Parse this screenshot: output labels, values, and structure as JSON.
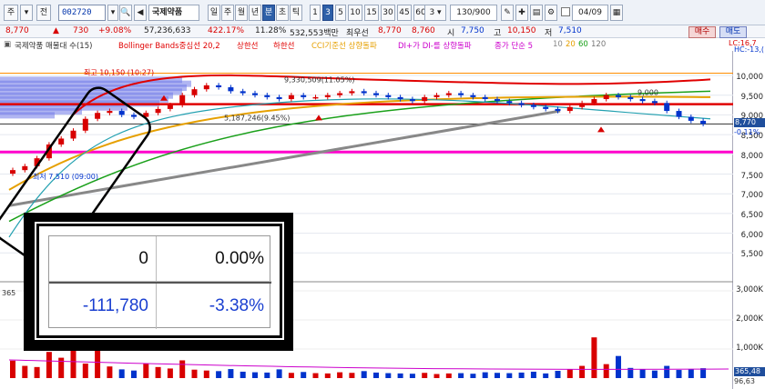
{
  "toolbar": {
    "period_main": "주",
    "period_sub": "전",
    "stock_code": "002720",
    "stock_name": "국제약품",
    "tabs": [
      "일",
      "주",
      "월",
      "년",
      "분",
      "초",
      "틱"
    ],
    "active_tab": "분",
    "minute_options": [
      "1",
      "3",
      "5",
      "10",
      "15",
      "30",
      "45",
      "60"
    ],
    "active_minute": "3",
    "interval_select": "3",
    "display_count": "130/900",
    "date": "04/09"
  },
  "price_bar": {
    "price": "8,770",
    "change": "730",
    "change_pct": "+9.08%",
    "volume": "57,236,633",
    "volume_ratio": "422.17%",
    "turnover_pct": "11.28%",
    "amount": "532,553백만",
    "best_label": "최우선",
    "best_ask": "8,770",
    "best_bid": "8,760",
    "open_label": "시",
    "open": "7,750",
    "high_label": "고",
    "high": "10,150",
    "low_label": "저",
    "low": "7,510",
    "buy_label": "매수",
    "sell_label": "매도"
  },
  "legend": {
    "title": "국제약품 매물대 수(15)",
    "bollinger": "Bollinger Bands중심선 20,2",
    "upper": "상한선",
    "lower": "하한선",
    "cci": "CCI기준선 상향돌파",
    "dmi": "DI+가 DI-를 상향돌파",
    "ma": "종가 단순 5",
    "ma_periods": [
      "10",
      "20",
      "60",
      "120"
    ],
    "lc": "LC:16,7",
    "hc": "HC:-13,("
  },
  "chart_annotations": {
    "high_mark": "최고 10,150 (10:27)",
    "low_mark": "최저 7,510 (09:00)",
    "left_value_1": "9,330,509(11.05%)",
    "left_value_2": "5,187,246(9.45%)",
    "right_mark": "9,000"
  },
  "price_axis": [
    "10,000",
    "9,500",
    "9,000",
    "8,500",
    "8,000",
    "7,500",
    "7,000",
    "6,500",
    "6,000",
    "5,500"
  ],
  "current_price_tag": "8,770",
  "current_pct_tag": "-0.11%",
  "volume_axis": [
    "3,000K",
    "2,000K",
    "1,000K"
  ],
  "volume_tag": "365,48",
  "volume_sub": "96,63",
  "volume_left_label": "365",
  "overlay": {
    "row1": {
      "qty": "0",
      "pct": "0.00%"
    },
    "row2": {
      "qty": "-111,780",
      "pct": "-3.38%"
    }
  },
  "colors": {
    "up": "#d80000",
    "down": "#0033cc",
    "magenta_line": "#ff00cc",
    "bollinger": "#e00000",
    "accent": "#2d5fa8"
  },
  "chart_data": {
    "type": "candlestick",
    "price_ticks": [
      10000,
      9500,
      9000,
      8500,
      8000,
      7500,
      7000,
      6500,
      6000,
      5500
    ],
    "closes": [
      7600,
      7700,
      7900,
      8250,
      8400,
      8600,
      8900,
      9050,
      9100,
      9000,
      8950,
      9050,
      9150,
      9250,
      9500,
      9650,
      9750,
      9700,
      9600,
      9550,
      9500,
      9450,
      9400,
      9500,
      9450,
      9450,
      9500,
      9550,
      9600,
      9550,
      9500,
      9450,
      9400,
      9350,
      9450,
      9500,
      9550,
      9500,
      9450,
      9400,
      9350,
      9300,
      9250,
      9200,
      9150,
      9100,
      9200,
      9300,
      9400,
      9500,
      9450,
      9400,
      9350,
      9300,
      9100,
      8950,
      8850,
      8770
    ],
    "volume_values": [
      600,
      420,
      380,
      900,
      700,
      1600,
      500,
      950,
      400,
      300,
      260,
      500,
      380,
      330,
      610,
      290,
      260,
      240,
      310,
      220,
      200,
      190,
      300,
      180,
      210,
      170,
      160,
      200,
      180,
      240,
      190,
      170,
      160,
      150,
      180,
      140,
      160,
      170,
      150,
      200,
      180,
      170,
      190,
      220,
      160,
      250,
      300,
      420,
      1400,
      480,
      760,
      350,
      300,
      260,
      420,
      280,
      300,
      340
    ]
  }
}
